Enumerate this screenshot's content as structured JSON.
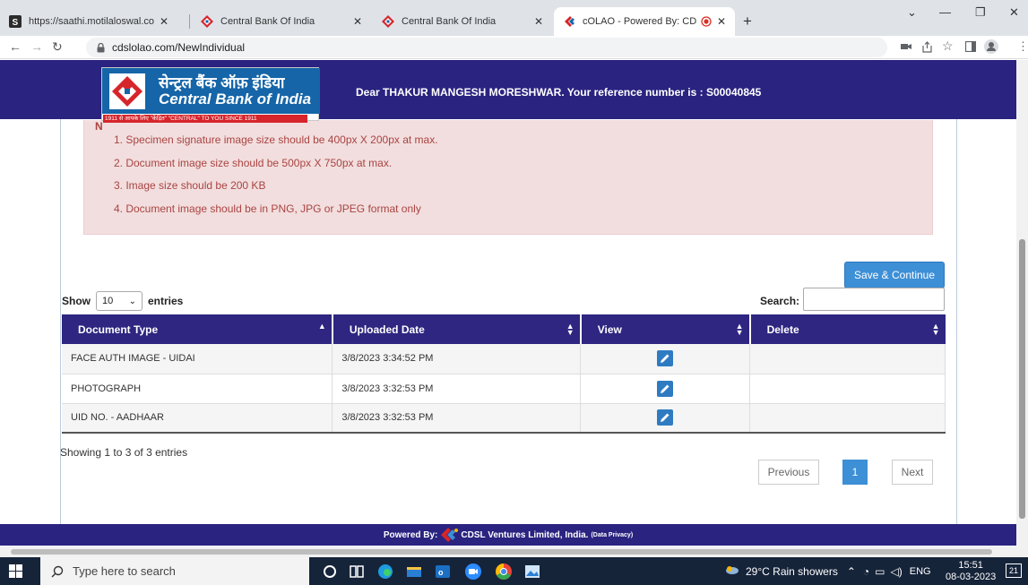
{
  "browser": {
    "tabs": [
      {
        "title": "https://saathi.motilaloswal.com/E"
      },
      {
        "title": "Central Bank Of India"
      },
      {
        "title": "Central Bank Of India"
      },
      {
        "title": "cOLAO - Powered By: CDSL \\"
      }
    ],
    "new_tab": "+",
    "address": "cdslolao.com/NewIndividual"
  },
  "header": {
    "logo_hindi": "सेन्ट्रल बैंक ऑफ़ इंडिया",
    "logo_english": "Central Bank of India",
    "logo_tagline": "1911 से आपके लिए \"केंद्रित\"   \"CENTRAL\" TO YOU SINCE 1911",
    "welcome": "Dear THAKUR MANGESH MORESHWAR. Your reference number is : S00040845"
  },
  "notice": {
    "lead": "N",
    "items": [
      "1. Specimen signature image size should be 400px X 200px at max.",
      "2. Document image size should be 500px X 750px at max.",
      "3. Image size should be 200 KB",
      "4. Document image should be in PNG, JPG or JPEG format only"
    ]
  },
  "actions": {
    "save_continue": "Save & Continue"
  },
  "table_controls": {
    "show": "Show",
    "page_length": "10",
    "entries": "entries",
    "search_label": "Search:"
  },
  "table": {
    "columns": [
      "Document Type",
      "Uploaded Date",
      "View",
      "Delete"
    ],
    "rows": [
      {
        "type": "FACE AUTH IMAGE - UIDAI",
        "date": "3/8/2023 3:34:52 PM"
      },
      {
        "type": "PHOTOGRAPH",
        "date": "3/8/2023 3:32:53 PM"
      },
      {
        "type": "UID NO. - AADHAAR",
        "date": "3/8/2023 3:32:53 PM"
      }
    ]
  },
  "pagination": {
    "info": "Showing 1 to 3 of 3 entries",
    "previous": "Previous",
    "current": "1",
    "next": "Next"
  },
  "footer": {
    "powered_by": "Powered By:",
    "company": "CDSL Ventures Limited, India.",
    "privacy": "(Data Privacy)"
  },
  "taskbar": {
    "search_placeholder": "Type here to search",
    "weather": "29°C  Rain showers",
    "language": "ENG",
    "time": "15:51",
    "date": "08-03-2023",
    "notifications": "21"
  },
  "colors": {
    "header_bg": "#2a2380",
    "notice_bg": "#f2dede",
    "notice_text": "#a94442",
    "primary_button": "#3d8fd6"
  }
}
